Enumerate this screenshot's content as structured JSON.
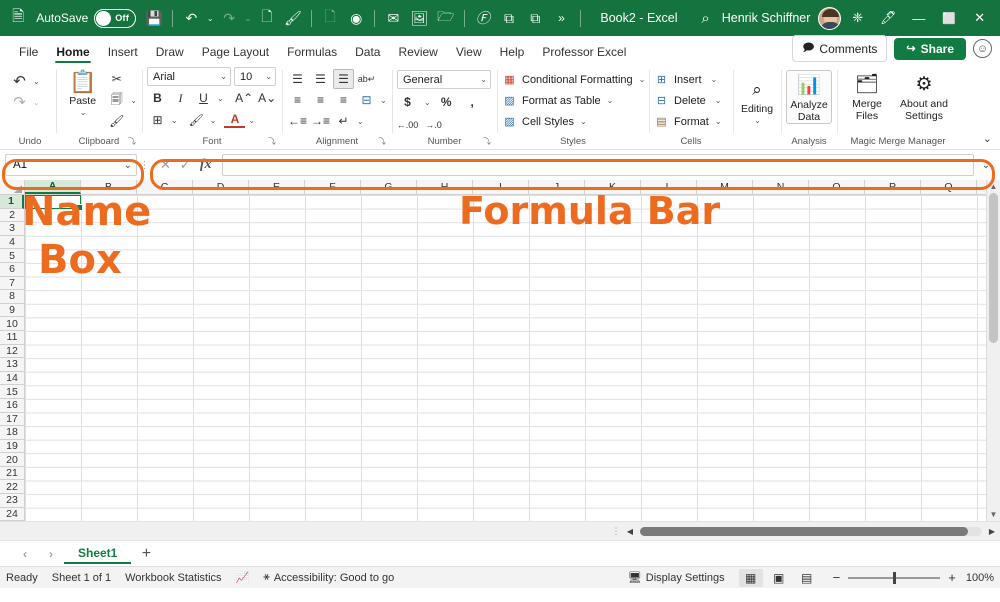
{
  "titlebar": {
    "app_icon": "excel-icon",
    "autosave_label": "AutoSave",
    "autosave_state": "Off",
    "document_title": "Book2  -  Excel",
    "user_name": "Henrik Schiffner",
    "qat_items": [
      {
        "name": "save-icon",
        "glyph": "💾",
        "dim": false
      },
      {
        "name": "undo-icon",
        "glyph": "↶",
        "dim": false
      },
      {
        "name": "redo-icon",
        "glyph": "↷",
        "dim": true
      },
      {
        "name": "quick-print-icon",
        "glyph": "🗋",
        "dim": false
      },
      {
        "name": "format-painter-icon",
        "glyph": "✎",
        "dim": false
      },
      {
        "name": "new-file-icon",
        "glyph": "📄",
        "dim": true
      },
      {
        "name": "record-macro-icon",
        "glyph": "◉",
        "dim": false
      },
      {
        "name": "email-icon",
        "glyph": "✉",
        "dim": false
      },
      {
        "name": "picture-icon",
        "glyph": "🖼",
        "dim": false
      },
      {
        "name": "open-folder-icon",
        "glyph": "🗁",
        "dim": false
      },
      {
        "name": "function-icon",
        "glyph": "⨍",
        "dim": false
      },
      {
        "name": "group-icon",
        "glyph": "⧉",
        "dim": false
      },
      {
        "name": "ungroup-icon",
        "glyph": "⧉",
        "dim": false
      },
      {
        "name": "qat-overflow-icon",
        "glyph": "»",
        "dim": false
      }
    ],
    "window_controls": [
      {
        "name": "search-icon",
        "glyph": "⌕"
      },
      {
        "name": "diamond-icon",
        "glyph": "❈"
      },
      {
        "name": "pen-icon",
        "glyph": "✎"
      },
      {
        "name": "minimize-button",
        "glyph": "—"
      },
      {
        "name": "maximize-button",
        "glyph": "☐"
      },
      {
        "name": "close-button",
        "glyph": "✕"
      }
    ]
  },
  "tabs": [
    {
      "label": "File",
      "active": false
    },
    {
      "label": "Home",
      "active": true
    },
    {
      "label": "Insert",
      "active": false
    },
    {
      "label": "Draw",
      "active": false
    },
    {
      "label": "Page Layout",
      "active": false
    },
    {
      "label": "Formulas",
      "active": false
    },
    {
      "label": "Data",
      "active": false
    },
    {
      "label": "Review",
      "active": false
    },
    {
      "label": "View",
      "active": false
    },
    {
      "label": "Help",
      "active": false
    },
    {
      "label": "Professor Excel",
      "active": false
    }
  ],
  "tabbar_right": {
    "comments_label": "Comments",
    "share_label": "Share",
    "smiley_icon": "smiley-icon"
  },
  "ribbon": {
    "groups": [
      {
        "label": "Undo"
      },
      {
        "label": "Clipboard",
        "paste_label": "Paste"
      },
      {
        "label": "Font",
        "font_name": "Arial",
        "font_size": "10"
      },
      {
        "label": "Alignment"
      },
      {
        "label": "Number",
        "format": "General"
      },
      {
        "label": "Styles",
        "items": [
          "Conditional Formatting",
          "Format as Table",
          "Cell Styles"
        ]
      },
      {
        "label": "Cells",
        "items": [
          "Insert",
          "Delete",
          "Format"
        ]
      },
      {
        "label": "",
        "editing_label": "Editing"
      },
      {
        "label": "Analysis",
        "analyze_label": "Analyze\nData",
        "analyze_line1": "Analyze",
        "analyze_line2": "Data"
      },
      {
        "label": "Magic Merge Manager",
        "merge_line1": "Merge",
        "merge_line2": "Files",
        "about_line1": "About and",
        "about_line2": "Settings"
      }
    ],
    "collapse_icon": "chevron-down-icon"
  },
  "formula_bar": {
    "name_box_value": "A1",
    "cancel_icon": "cancel-icon",
    "enter_icon": "confirm-icon",
    "fx_icon": "fx-icon",
    "formula_value": "",
    "expand_icon": "chevron-down-icon"
  },
  "grid": {
    "columns": [
      "A",
      "B",
      "C",
      "D",
      "E",
      "F",
      "G",
      "H",
      "I",
      "J",
      "K",
      "L",
      "M",
      "N",
      "O",
      "P",
      "Q"
    ],
    "rows": [
      1,
      2,
      3,
      4,
      5,
      6,
      7,
      8,
      9,
      10,
      11,
      12,
      13,
      14,
      15,
      16,
      17,
      18,
      19,
      20,
      21,
      22,
      23,
      24
    ],
    "selected_cell": "A1"
  },
  "sheet_tabs": {
    "prev_icon": "chevron-left-icon",
    "next_icon": "chevron-right-icon",
    "tabs": [
      {
        "label": "Sheet1",
        "active": true
      }
    ],
    "add_label": "+"
  },
  "status_bar": {
    "state": "Ready",
    "sheet_count": "Sheet 1 of 1",
    "workbook_statistics": "Workbook Statistics",
    "stats_icon": "statistics-icon",
    "accessibility_icon": "accessibility-icon",
    "accessibility": "Accessibility: Good to go",
    "display_settings": "Display Settings",
    "view_normal_icon": "normal-view-icon",
    "view_pagelayout_icon": "page-layout-view-icon",
    "view_pagebreak_icon": "page-break-view-icon",
    "zoom_out": "−",
    "zoom_in": "+",
    "zoom_level": "100%"
  },
  "annotations": [
    {
      "name": "name-box-annotation",
      "text": "Name Box",
      "line1": "Name",
      "line2": "Box",
      "color": "#ED6B1F"
    },
    {
      "name": "formula-bar-annotation",
      "text": "Formula Bar",
      "color": "#ED6B1F"
    }
  ],
  "colors": {
    "excel_green": "#15733f",
    "accent_green": "#107c41",
    "annotation_orange": "#ED6B1F"
  }
}
